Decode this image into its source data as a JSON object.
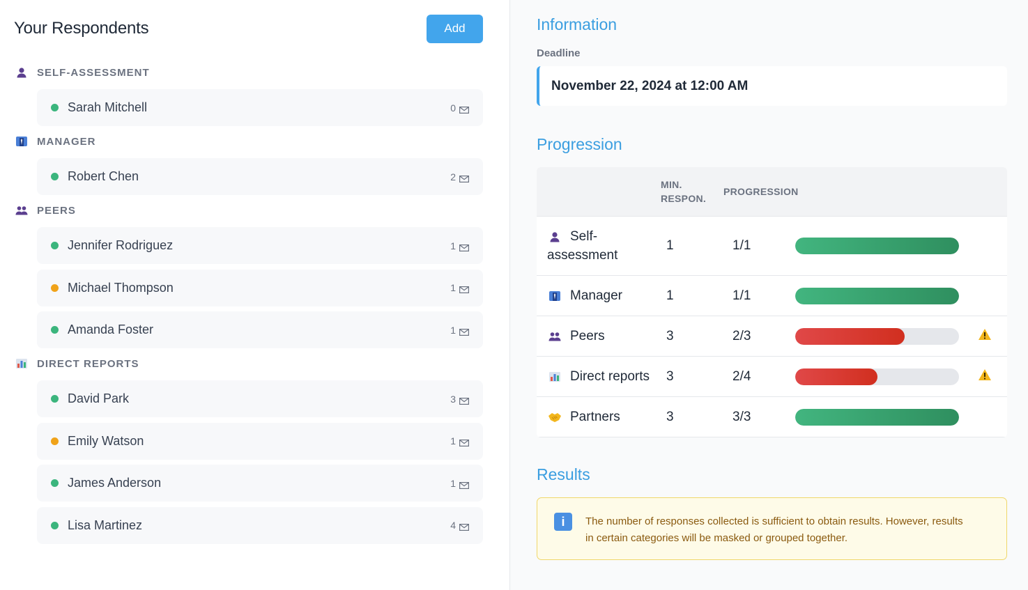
{
  "respondents": {
    "title": "Your Respondents",
    "add_label": "Add",
    "groups": [
      {
        "label": "SELF-ASSESSMENT",
        "icon": "person-icon",
        "people": [
          {
            "name": "Sarah Mitchell",
            "count": "0",
            "status": "green"
          }
        ]
      },
      {
        "label": "MANAGER",
        "icon": "manager-icon",
        "people": [
          {
            "name": "Robert Chen",
            "count": "2",
            "status": "green"
          }
        ]
      },
      {
        "label": "PEERS",
        "icon": "peers-icon",
        "people": [
          {
            "name": "Jennifer Rodriguez",
            "count": "1",
            "status": "green"
          },
          {
            "name": "Michael Thompson",
            "count": "1",
            "status": "orange"
          },
          {
            "name": "Amanda Foster",
            "count": "1",
            "status": "green"
          }
        ]
      },
      {
        "label": "DIRECT REPORTS",
        "icon": "direct-reports-icon",
        "people": [
          {
            "name": "David Park",
            "count": "3",
            "status": "green"
          },
          {
            "name": "Emily Watson",
            "count": "1",
            "status": "orange"
          },
          {
            "name": "James Anderson",
            "count": "1",
            "status": "green"
          },
          {
            "name": "Lisa Martinez",
            "count": "4",
            "status": "green"
          }
        ]
      }
    ]
  },
  "information": {
    "title": "Information",
    "deadline_label": "Deadline",
    "deadline_value": "November 22, 2024 at 12:00 AM"
  },
  "progression": {
    "title": "Progression",
    "col_min_line1": "MIN.",
    "col_min_line2": "RESPON.",
    "col_progression": "PROGRESSION",
    "rows": [
      {
        "category_line1": "Self-",
        "category_line2": "assessment",
        "icon": "person-icon",
        "min": "1",
        "progress": "1/1",
        "fraction": 1.0,
        "warning": false
      },
      {
        "category_line1": "Manager",
        "category_line2": "",
        "icon": "manager-icon",
        "min": "1",
        "progress": "1/1",
        "fraction": 1.0,
        "warning": false
      },
      {
        "category_line1": "Peers",
        "category_line2": "",
        "icon": "peers-icon",
        "min": "3",
        "progress": "2/3",
        "fraction": 0.667,
        "warning": true
      },
      {
        "category_line1": "Direct reports",
        "category_line2": "",
        "icon": "direct-reports-icon",
        "min": "3",
        "progress": "2/4",
        "fraction": 0.5,
        "warning": true
      },
      {
        "category_line1": "Partners",
        "category_line2": "",
        "icon": "handshake-icon",
        "min": "3",
        "progress": "3/3",
        "fraction": 1.0,
        "warning": false
      }
    ]
  },
  "results": {
    "title": "Results",
    "notice_line1": "The number of responses collected is sufficient to obtain results. However, results",
    "notice_line2": "in certain categories will be masked or grouped together."
  },
  "colors": {
    "accent": "#42a5ec",
    "ok_status": "#3bb57d",
    "pending_status": "#f0a31a",
    "bar_ok": "#3aa571",
    "bar_low": "#da3a30"
  }
}
